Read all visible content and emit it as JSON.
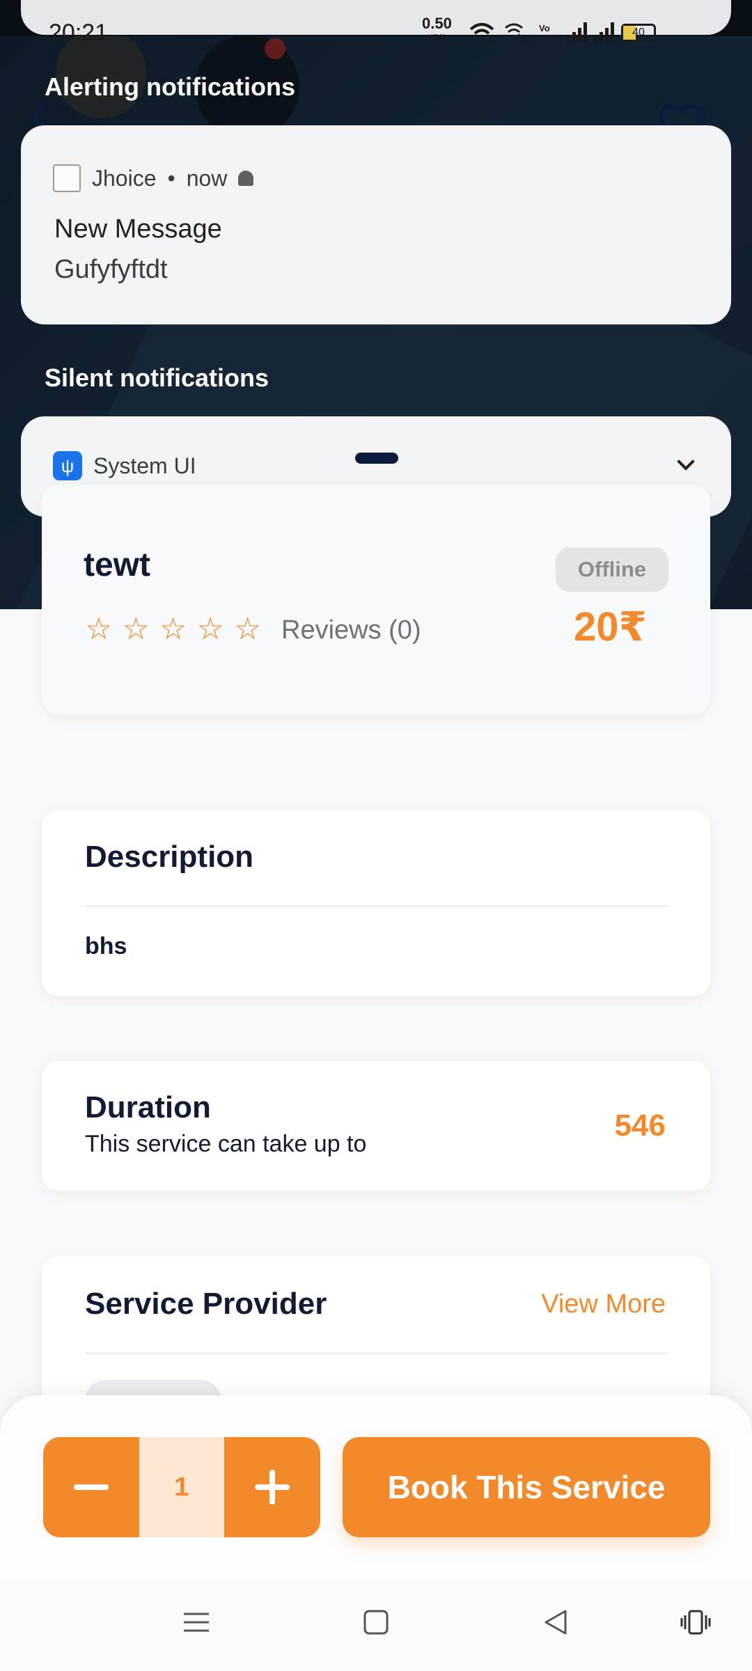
{
  "status_bar": {
    "time": "20:21",
    "speed": "0.50",
    "speed_unit": "KB/S",
    "battery": "40"
  },
  "shade": {
    "alerting_title": "Alerting notifications",
    "alert": {
      "app": "Jhoice",
      "when": "now",
      "title": "New Message",
      "text": "Gufyfyftdt"
    },
    "silent_title": "Silent notifications",
    "silent": {
      "app": "System UI"
    }
  },
  "service": {
    "name": "tewt",
    "status": "Offline",
    "price": "20₹",
    "rating": 0,
    "reviews": "Reviews (0)"
  },
  "description": {
    "title": "Description",
    "text": "bhs"
  },
  "duration": {
    "title": "Duration",
    "subtitle": "This service can take up to",
    "value": "546"
  },
  "provider": {
    "title": "Service Provider",
    "link": "View More"
  },
  "booking": {
    "quantity": "1",
    "book_label": "Book This Service"
  },
  "colors": {
    "accent": "#f2892a",
    "navy": "#131b34",
    "hero": "#0d1a26"
  }
}
